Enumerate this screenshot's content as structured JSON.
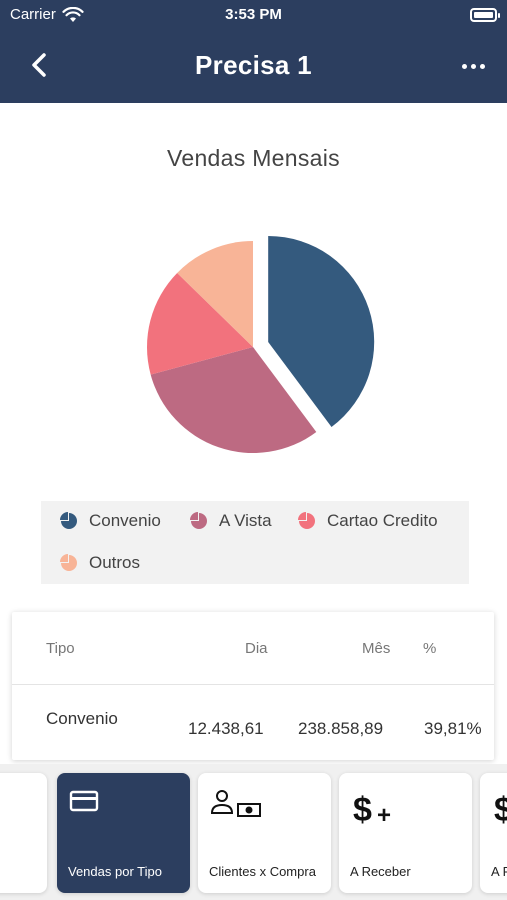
{
  "status_bar": {
    "carrier": "Carrier",
    "time": "3:53 PM"
  },
  "nav": {
    "title": "Precisa 1",
    "back_icon": "chevron-left-icon",
    "more_icon": "ellipsis-icon"
  },
  "chart_data": {
    "type": "pie",
    "title": "Vendas Mensais",
    "categories": [
      "Convenio",
      "A Vista",
      "Cartao Credito",
      "Outros"
    ],
    "values": [
      39.81,
      31.0,
      16.5,
      12.69
    ],
    "colors": [
      "#345a7e",
      "#bd6a82",
      "#f2727d",
      "#f8b497"
    ],
    "exploded": "Convenio"
  },
  "legend": {
    "items": [
      {
        "label": "Convenio",
        "color": "#345a7e"
      },
      {
        "label": "A Vista",
        "color": "#bd6a82"
      },
      {
        "label": "Cartao Credito",
        "color": "#f2727d"
      },
      {
        "label": "Outros",
        "color": "#f8b497"
      }
    ]
  },
  "table": {
    "headers": {
      "tipo": "Tipo",
      "dia": "Dia",
      "mes": "Mês",
      "pct": "%"
    },
    "rows": [
      {
        "tipo": "Convenio",
        "dia": "12.438,61",
        "mes": "238.858,89",
        "pct": "39,81%"
      }
    ]
  },
  "tabs": [
    {
      "label": "",
      "icon": ""
    },
    {
      "label": "Vendas por Tipo",
      "icon": "credit-card-icon",
      "active": true
    },
    {
      "label": "Clientes x Compra",
      "icon": "customer-money-icon"
    },
    {
      "label": "A Receber",
      "icon": "dollar-plus-icon"
    },
    {
      "label": "A R",
      "icon": "dollar-icon"
    }
  ]
}
